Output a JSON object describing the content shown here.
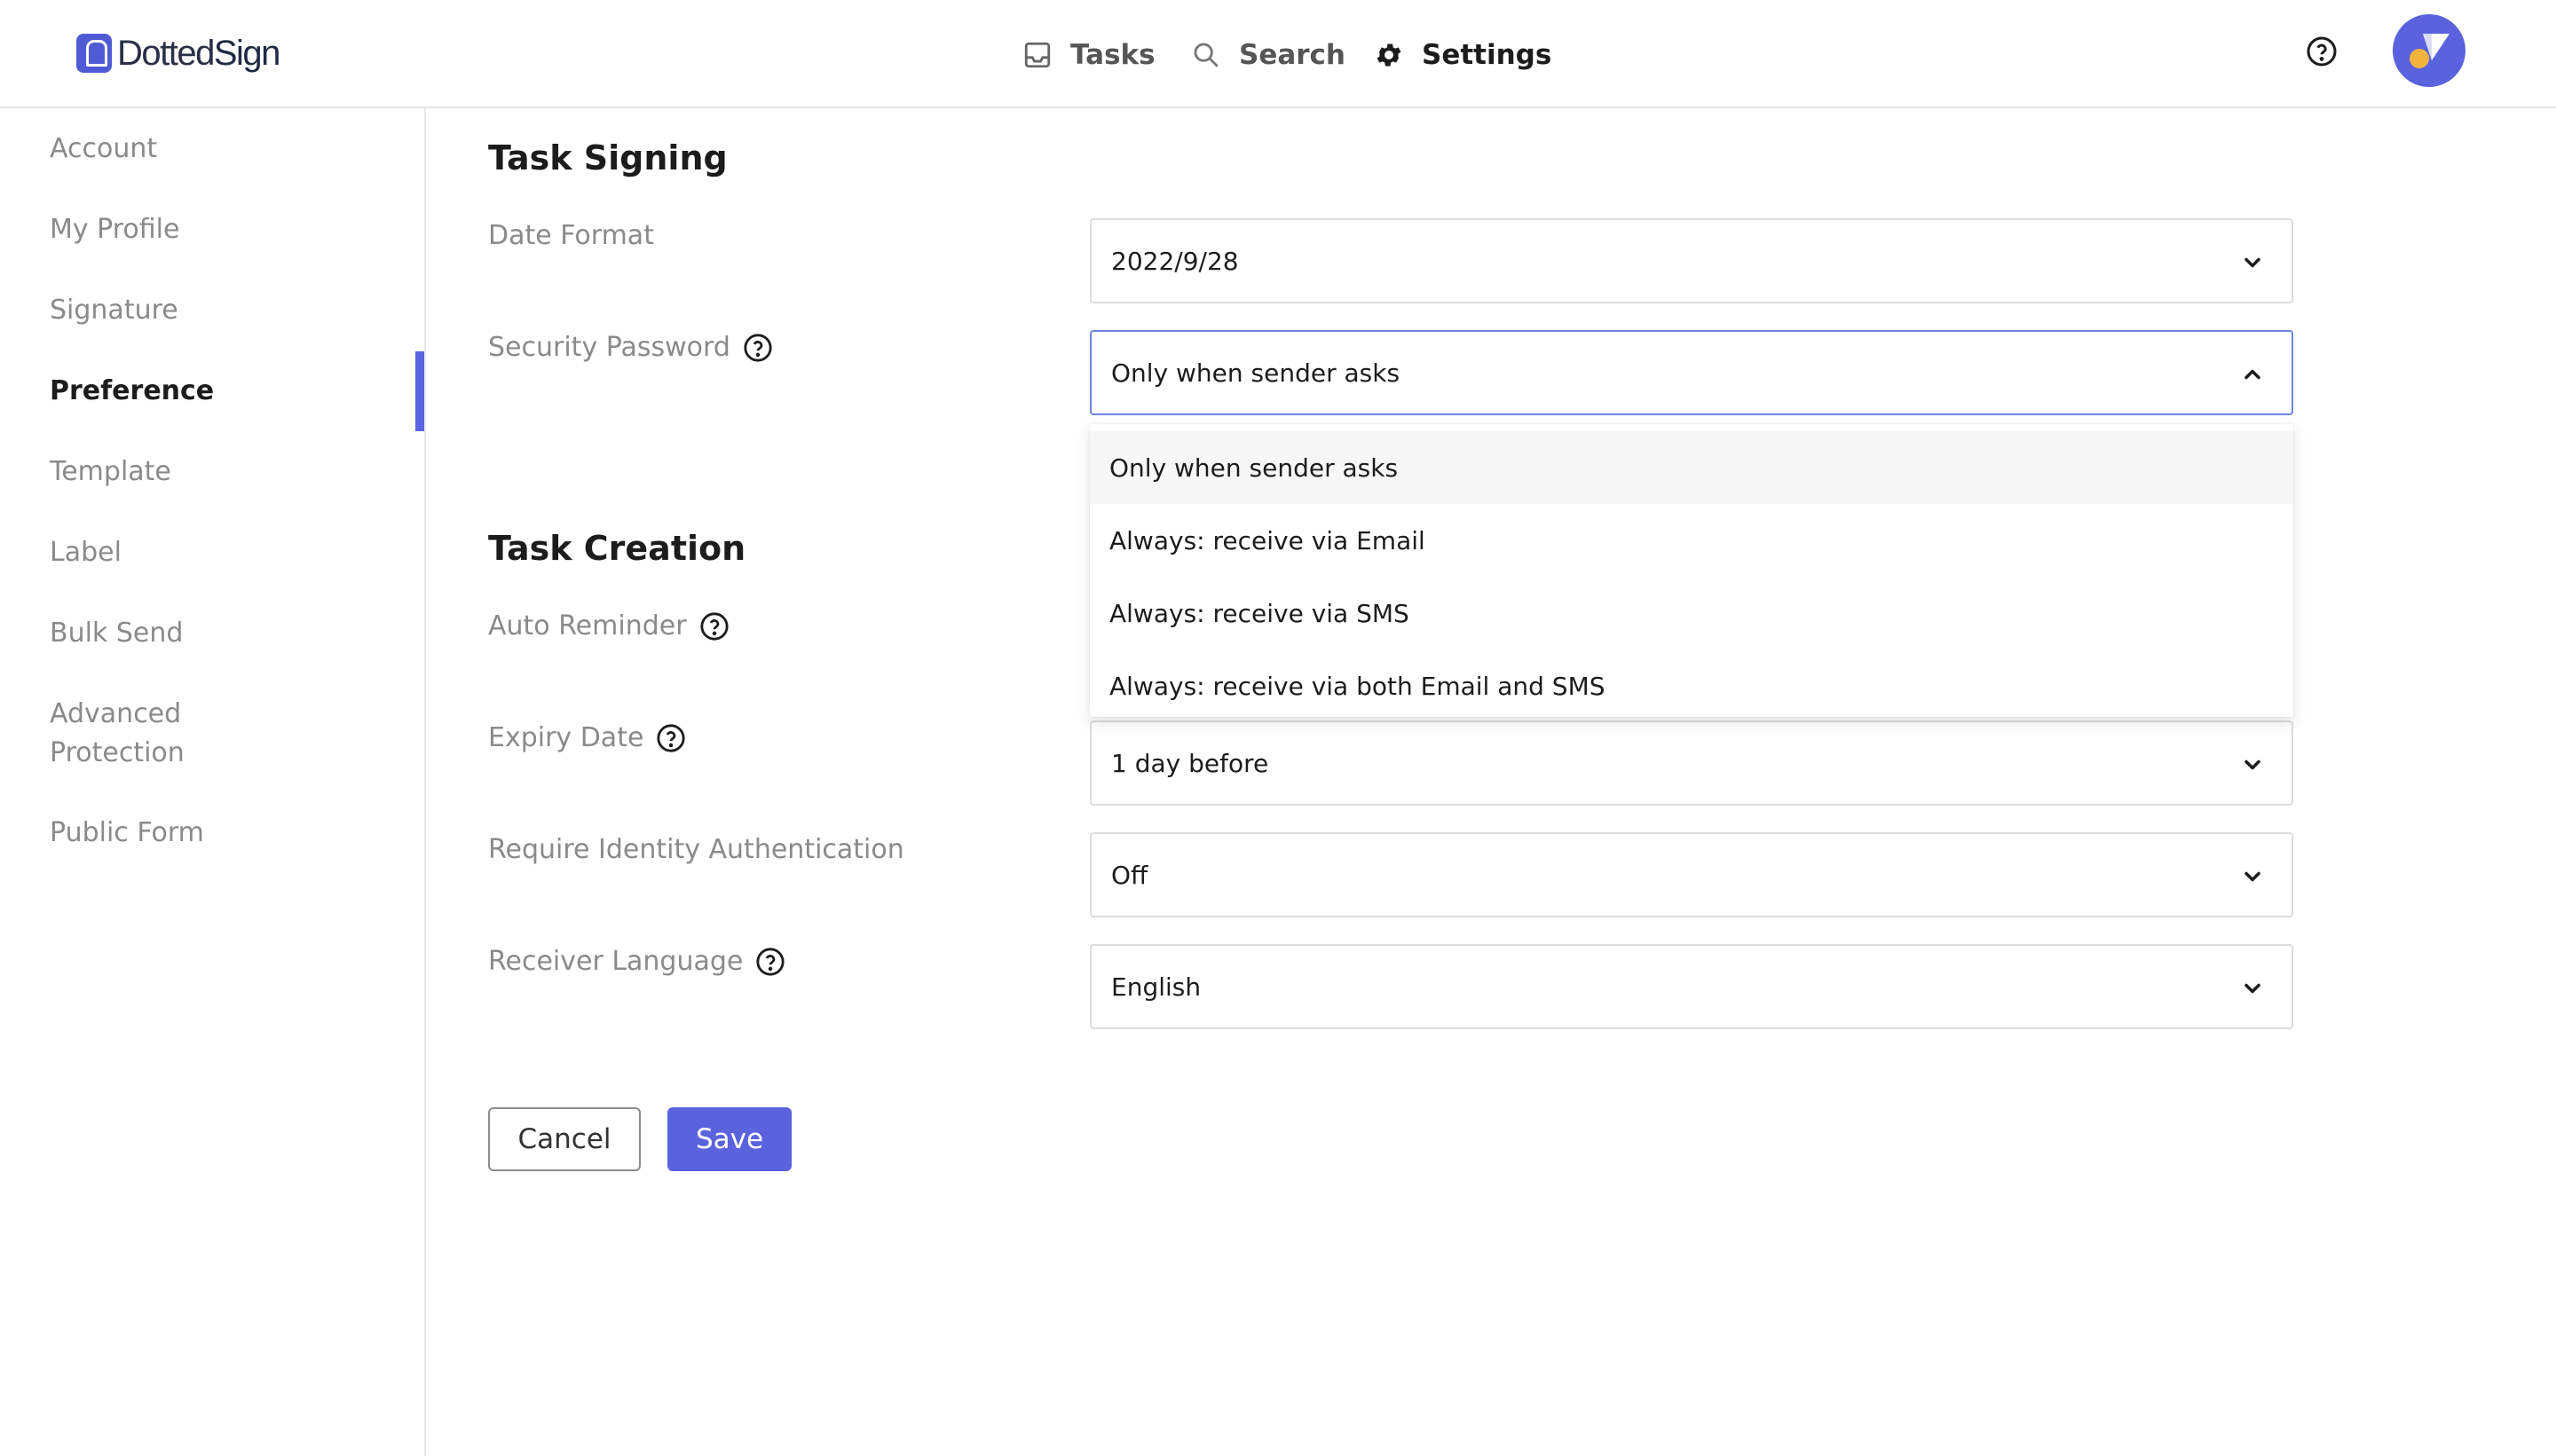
{
  "header": {
    "logo": {
      "part1": "Dotted",
      "part2": "Sign"
    },
    "nav": [
      {
        "label": "Tasks",
        "icon": "inbox-icon"
      },
      {
        "label": "Search",
        "icon": "search-icon"
      },
      {
        "label": "Settings",
        "icon": "gear-icon",
        "active": true
      }
    ],
    "help_icon": "help-circle-icon",
    "avatar_icon": "avatar"
  },
  "sidebar": {
    "items": [
      {
        "label": "Account"
      },
      {
        "label": "My Profile"
      },
      {
        "label": "Signature"
      },
      {
        "label": "Preference",
        "active": true
      },
      {
        "label": "Template"
      },
      {
        "label": "Label"
      },
      {
        "label": "Bulk Send"
      },
      {
        "label": "Advanced\nProtection"
      },
      {
        "label": "Public Form"
      }
    ]
  },
  "task_signing": {
    "title": "Task Signing",
    "date_format": {
      "label": "Date Format",
      "value": "2022/9/28"
    },
    "security_password": {
      "label": "Security Password",
      "value": "Only when sender asks",
      "options": [
        "Only when sender asks",
        "Always: receive via Email",
        "Always: receive via SMS",
        "Always: receive via both Email and SMS"
      ]
    }
  },
  "task_creation": {
    "title": "Task Creation",
    "auto_reminder": {
      "label": "Auto Reminder"
    },
    "expiry_date": {
      "label": "Expiry Date",
      "value": "1 day before"
    },
    "identity_auth": {
      "label": "Require Identity Authentication",
      "value": "Off"
    },
    "receiver_language": {
      "label": "Receiver Language",
      "value": "English"
    }
  },
  "actions": {
    "cancel": "Cancel",
    "save": "Save"
  },
  "colors": {
    "accent": "#5a63dd",
    "focus_border": "#6a86e0",
    "avatar_dot": "#f0b43c"
  }
}
